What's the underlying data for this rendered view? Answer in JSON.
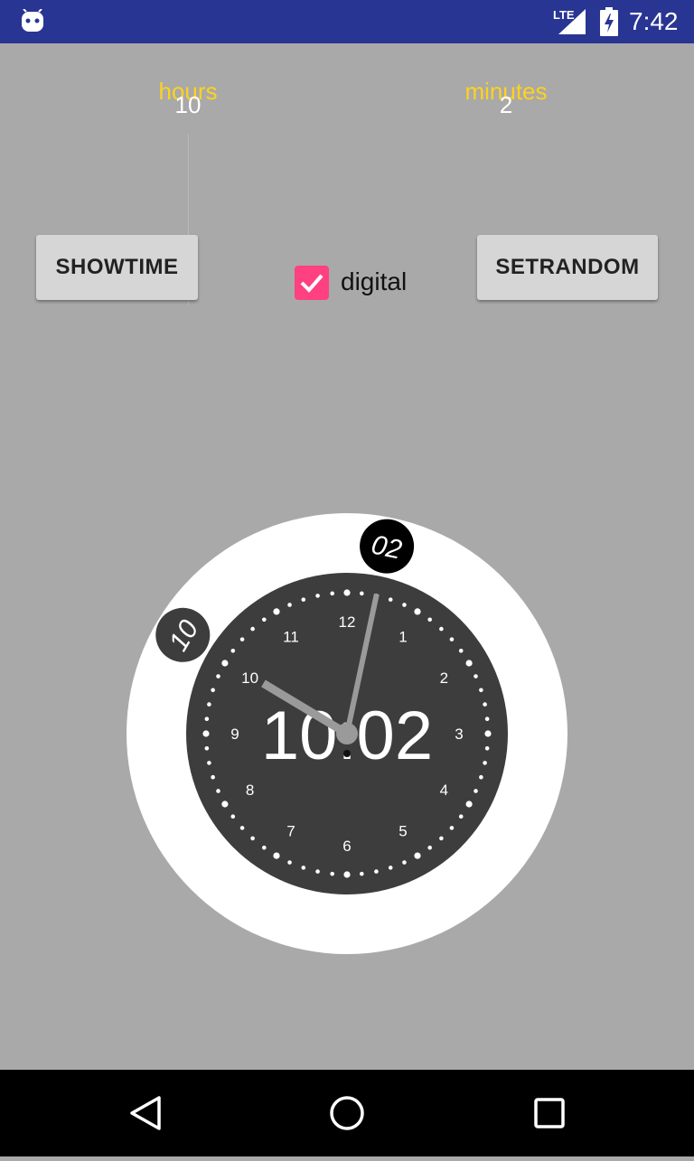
{
  "status_bar": {
    "network": "LTE",
    "time": "7:42",
    "icons": [
      "android-icon",
      "signal-icon",
      "battery-charging-icon"
    ],
    "color": "#283593"
  },
  "pickers": {
    "hours": {
      "label": "hours",
      "value": "10"
    },
    "minutes": {
      "label": "minutes",
      "value": "2"
    }
  },
  "buttons": {
    "showtime": "SHOWTIME",
    "setrandom": "SETRANDOM"
  },
  "digital_checkbox": {
    "label": "digital",
    "checked": true,
    "color": "#ff4081"
  },
  "clock": {
    "hour": 10,
    "minute": 2,
    "digital_text": "10:02",
    "hour_bubble": "10",
    "minute_bubble": "02",
    "dial_numbers": [
      "12",
      "1",
      "2",
      "3",
      "4",
      "5",
      "6",
      "7",
      "8",
      "9",
      "10",
      "11"
    ],
    "colors": {
      "ring": "#ffffff",
      "face": "#3e3d3e",
      "hands": "#9a9a9a"
    }
  },
  "nav_bar": {
    "icons": [
      "back-icon",
      "home-icon",
      "recents-icon"
    ]
  }
}
